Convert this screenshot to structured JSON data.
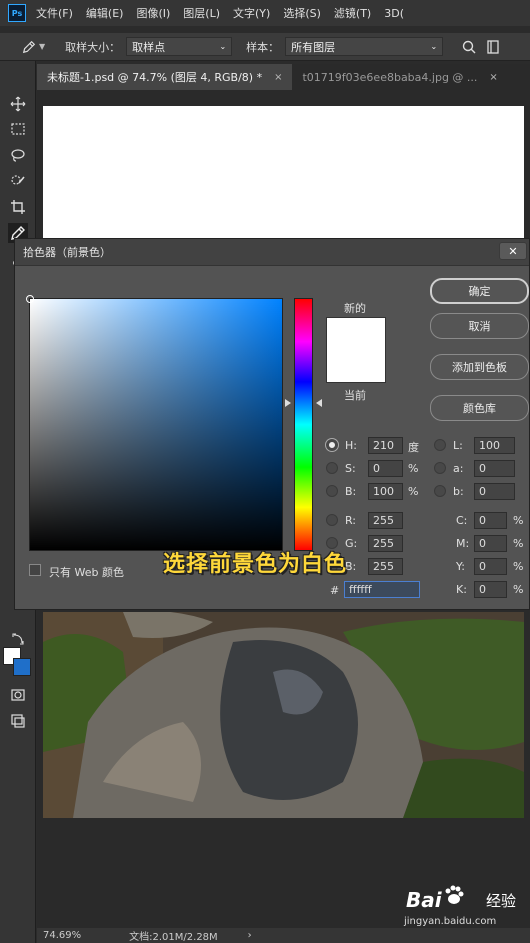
{
  "menubar": {
    "logo": "Ps",
    "items": [
      "文件(F)",
      "编辑(E)",
      "图像(I)",
      "图层(L)",
      "文字(Y)",
      "选择(S)",
      "滤镜(T)",
      "3D("
    ]
  },
  "options_bar": {
    "sample_size_label": "取样大小：",
    "sample_size_value": "取样点",
    "sample_label": "样本：",
    "sample_value": "所有图层"
  },
  "tabs": [
    {
      "label": "未标题-1.psd @ 74.7% (图层 4, RGB/8) *",
      "close": "×"
    },
    {
      "label": "t01719f03e6ee8baba4.jpg @ ...",
      "close": "×"
    }
  ],
  "status": {
    "zoom": "74.69%",
    "doc_info": "文档:2.01M/2.28M"
  },
  "dialog": {
    "title": "拾色器（前景色）",
    "close": "✕",
    "new_label": "新的",
    "current_label": "当前",
    "buttons": {
      "ok": "确定",
      "cancel": "取消",
      "add_to_swatches": "添加到色板",
      "color_libraries": "颜色库"
    },
    "fields": {
      "H": {
        "label": "H:",
        "value": "210",
        "unit": "度"
      },
      "S": {
        "label": "S:",
        "value": "0",
        "unit": "%"
      },
      "B": {
        "label": "B:",
        "value": "100",
        "unit": "%"
      },
      "R": {
        "label": "R:",
        "value": "255"
      },
      "G": {
        "label": "G:",
        "value": "255"
      },
      "Bv": {
        "label": "B:",
        "value": "255"
      },
      "L": {
        "label": "L:",
        "value": "100"
      },
      "a": {
        "label": "a:",
        "value": "0"
      },
      "b": {
        "label": "b:",
        "value": "0"
      },
      "C": {
        "label": "C:",
        "value": "0",
        "unit": "%"
      },
      "M": {
        "label": "M:",
        "value": "0",
        "unit": "%"
      },
      "Y": {
        "label": "Y:",
        "value": "0",
        "unit": "%"
      },
      "K": {
        "label": "K:",
        "value": "0",
        "unit": "%"
      },
      "hex": {
        "label": "#",
        "value": "ffffff"
      }
    },
    "web_only_label": "只有 Web 颜色",
    "new_color": "#ffffff"
  },
  "subtitle": "选择前景色为白色",
  "watermark": {
    "brand": "Bai",
    "brand_suffix": "经验",
    "url": "jingyan.baidu.com"
  },
  "colors": {
    "ps_blue": "#31a8ff",
    "caption_yellow": "#ffd83a"
  }
}
